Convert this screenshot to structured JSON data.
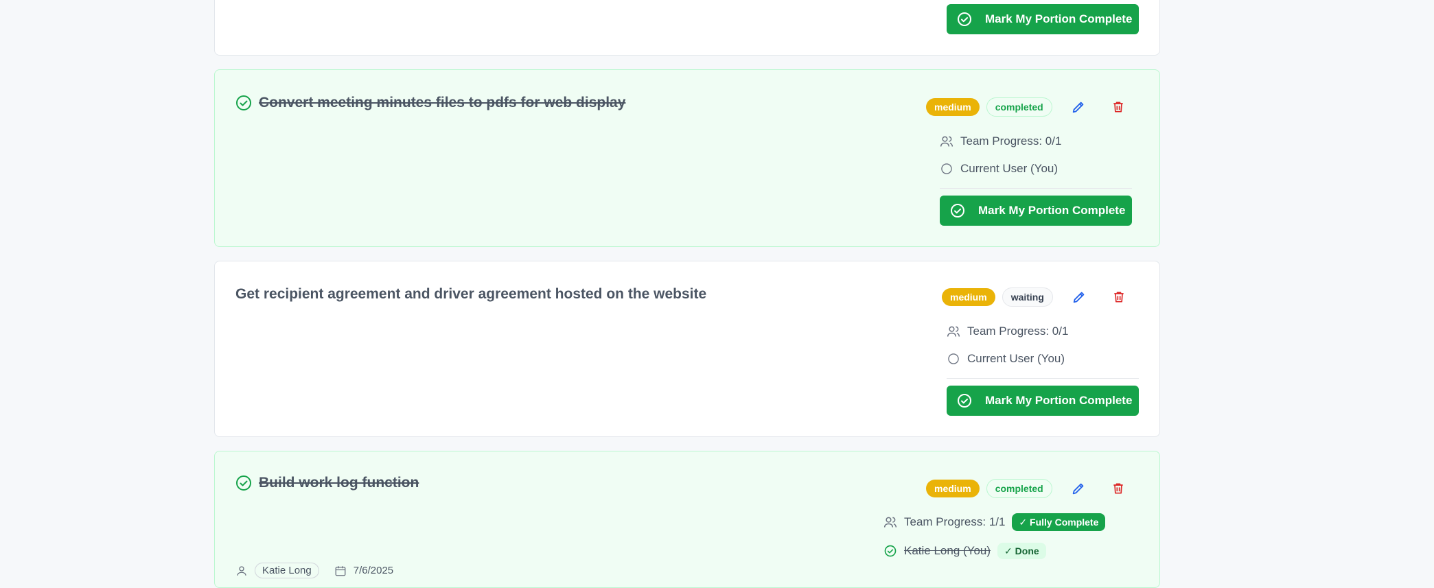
{
  "tasks": [
    {
      "button_label": "Mark My Portion Complete"
    },
    {
      "title": "Convert meeting minutes files to pdfs for web display",
      "priority": "medium",
      "status": "completed",
      "team_progress": "Team Progress: 0/1",
      "member": "Current User (You)",
      "button_label": "Mark My Portion Complete"
    },
    {
      "title": "Get recipient agreement and driver agreement hosted on the website",
      "priority": "medium",
      "status": "waiting",
      "team_progress": "Team Progress: 0/1",
      "member": "Current User (You)",
      "button_label": "Mark My Portion Complete"
    },
    {
      "title": "Build work log function",
      "priority": "medium",
      "status": "completed",
      "team_progress": "Team Progress: 1/1",
      "fully_complete": "✓ Fully Complete",
      "member": "Katie Long (You)",
      "member_done": "✓ Done",
      "assignee": "Katie Long",
      "date": "7/6/2025"
    }
  ],
  "colors": {
    "accent_green": "#16a34a",
    "priority_yellow": "#eab308",
    "edit_blue": "#2563eb",
    "delete_red": "#dc2626"
  }
}
